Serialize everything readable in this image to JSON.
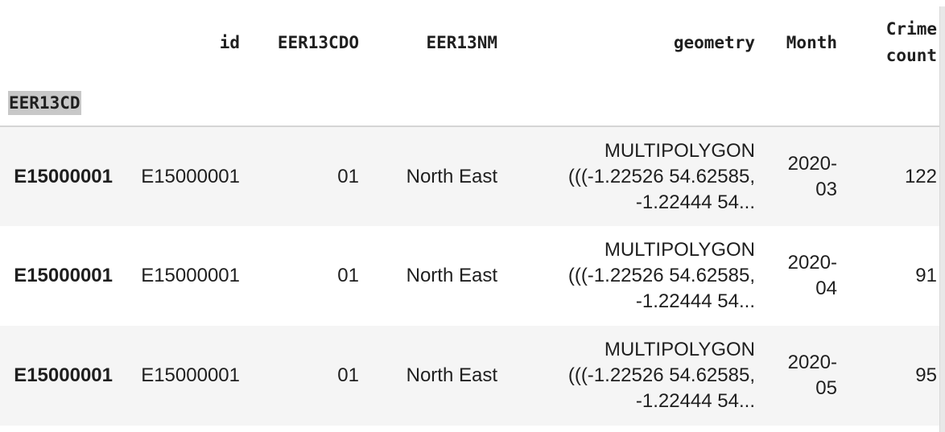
{
  "table": {
    "columns": [
      "id",
      "EER13CDO",
      "EER13NM",
      "geometry",
      "Month",
      "Crime count"
    ],
    "crime_col": {
      "line1": "Crime",
      "line2": "count"
    },
    "index_name": "EER13CD",
    "rows": [
      {
        "index": "E15000001",
        "id": "E15000001",
        "EER13CDO": "01",
        "EER13NM": "North East",
        "geometry": [
          "MULTIPOLYGON",
          "(((-1.22526 54.62585,",
          "-1.22444 54..."
        ],
        "month": [
          "2020-",
          "03"
        ],
        "crime_count": "122"
      },
      {
        "index": "E15000001",
        "id": "E15000001",
        "EER13CDO": "01",
        "EER13NM": "North East",
        "geometry": [
          "MULTIPOLYGON",
          "(((-1.22526 54.62585,",
          "-1.22444 54..."
        ],
        "month": [
          "2020-",
          "04"
        ],
        "crime_count": "91"
      },
      {
        "index": "E15000001",
        "id": "E15000001",
        "EER13CDO": "01",
        "EER13NM": "North East",
        "geometry": [
          "MULTIPOLYGON",
          "(((-1.22526 54.62585,",
          "-1.22444 54..."
        ],
        "month": [
          "2020-",
          "05"
        ],
        "crime_count": "95"
      }
    ]
  },
  "colors": {
    "row_striped": "#f5f5f5",
    "row_plain": "#ffffff",
    "index_highlight": "#c8c8c8",
    "header_border": "#d5d5d5"
  }
}
